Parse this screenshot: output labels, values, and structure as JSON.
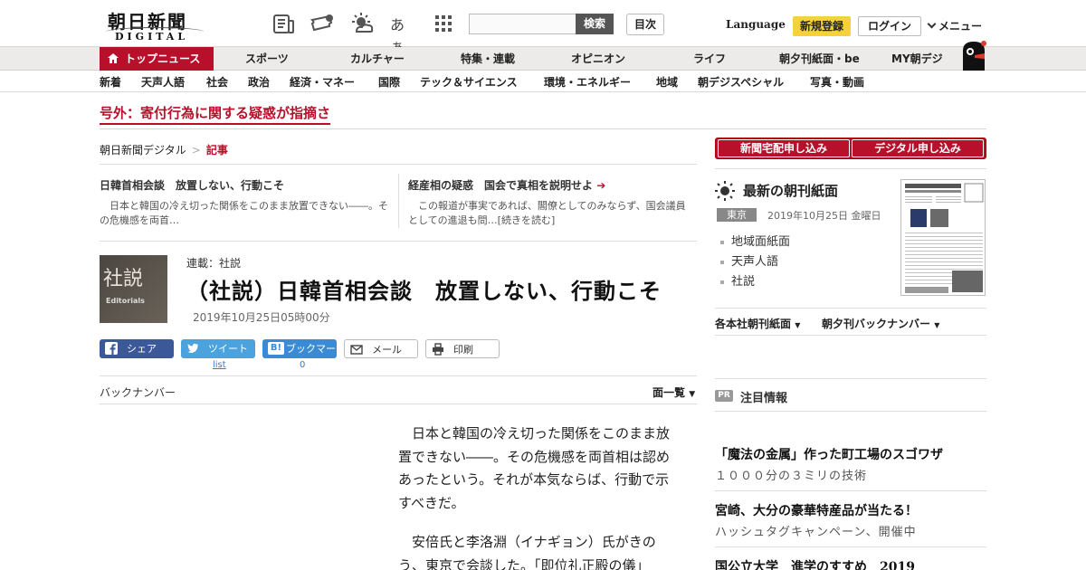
{
  "header": {
    "logo_kanji": "朝日新聞",
    "logo_sub": "DIGITAL",
    "search_button": "検索",
    "toc_button": "目次",
    "language": "Language",
    "register": "新規登録",
    "login": "ログイン",
    "menu": "メニュー",
    "icons": [
      "newspaper-icon",
      "ticket-icon",
      "weather-icon",
      "font-size-icon",
      "grid-icon"
    ],
    "font_icon_text": "あぁ"
  },
  "nav_primary": [
    {
      "label": "トップニュース",
      "active": true
    },
    {
      "label": "スポーツ"
    },
    {
      "label": "カルチャー"
    },
    {
      "label": "特集・連載"
    },
    {
      "label": "オピニオン"
    },
    {
      "label": "ライフ"
    },
    {
      "label": "朝夕刊紙面・be"
    },
    {
      "label": "MY朝デジ"
    }
  ],
  "nav_secondary": [
    "新着",
    "天声人語",
    "社会",
    "政治",
    "経済・マネー",
    "国際",
    "テック＆サイエンス",
    "環境・エネルギー",
    "地域",
    "朝デジスペシャル",
    "写真・動画"
  ],
  "breaking": "号外：寄付行為に関する疑惑が指摘さ",
  "breadcrumb": {
    "home": "朝日新聞デジタル",
    "sep": ">",
    "current": "記事"
  },
  "related": [
    {
      "title": "日韓首相会談　放置しない、行動こそ",
      "summary": "日本と韓国の冷え切った関係をこのまま放置できない――。その危機感を両首…"
    },
    {
      "title": "経産相の疑惑　国会で真相を説明せよ",
      "summary": "この報道が事実であれば、閣僚としてのみならず、国会議員としての進退も問…[続きを読む]"
    }
  ],
  "article": {
    "thumb_big": "社説",
    "thumb_small": "Editorials",
    "series": "連載：社説",
    "headline": "（社説）日韓首相会談　放置しない、行動こそ",
    "date": "2019年10月25日05時00分",
    "back_numbers": "バックナンバー",
    "page_list": "面一覧",
    "paragraphs": [
      "日本と韓国の冷え切った関係をこのまま放置できない――。その危機感を両首相は認めあったという。それが本気ならば、行動で示すべきだ。",
      "安倍氏と李洛淵（イナギョン）氏がきのう、東京で会談した。「即位礼正殿の儀」"
    ]
  },
  "share": {
    "facebook": "シェア",
    "twitter": "ツイート",
    "hatena": "ブックマーク",
    "hatena_badge": "B!",
    "mail": "メール",
    "print": "印刷",
    "twitter_count": "list",
    "hatena_count": "0",
    "colors": {
      "facebook": "#3b5998",
      "twitter": "#4aa3df",
      "hatena": "#3a8bd5"
    }
  },
  "sidebar": {
    "subscribe_paper": "新聞宅配申し込み",
    "subscribe_digital": "デジタル申し込み",
    "latest_title": "最新の朝刊紙面",
    "region": "東京",
    "paper_date": "2019年10月25日 金曜日",
    "paper_links": [
      "地域面紙面",
      "天声人語",
      "社説"
    ],
    "dropdown_1": "各本社朝刊紙面",
    "dropdown_2": "朝夕刊バックナンバー",
    "pr_badge": "PR",
    "pr_title": "注目情報",
    "pr_items": [
      {
        "title": "「魔法の金属」作った町工場のスゴワザ",
        "sub": "１０００分の３ミリの技術"
      },
      {
        "title": "宮崎、大分の豪華特産品が当たる！",
        "sub": "ハッシュタグキャンペーン、開催中"
      },
      {
        "title": "国公立大学　進学のすすめ　2019",
        "sub": ""
      }
    ]
  },
  "colors": {
    "brand_red": "#b8102a",
    "register_yellow": "#f5d23c"
  }
}
